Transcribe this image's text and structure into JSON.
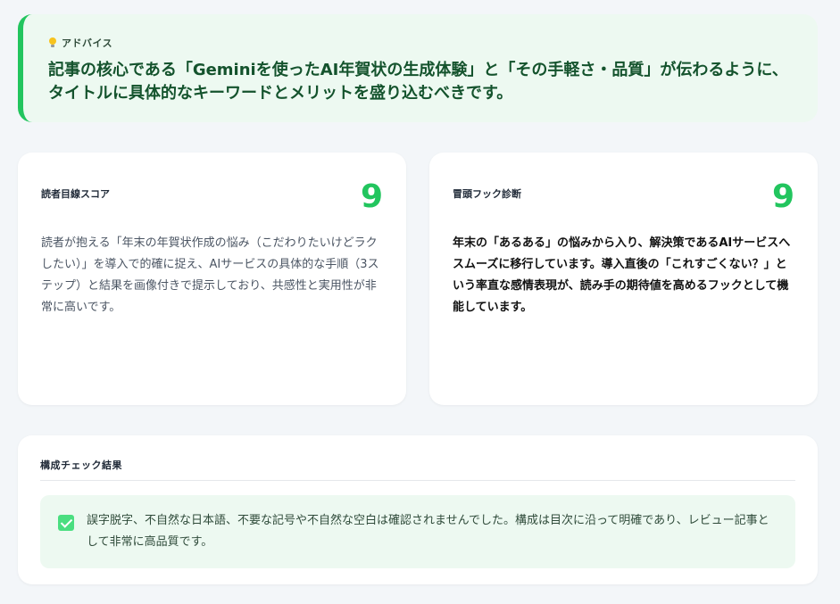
{
  "advice": {
    "icon": "lightbulb-icon",
    "label": "アドバイス",
    "text": "記事の核心である「Geminiを使ったAI年賀状の生成体験」と「その手軽さ・品質」が伝わるように、タイトルに具体的なキーワードとメリットを盛り込むべきです。"
  },
  "reader_score": {
    "title": "読者目線スコア",
    "score": "9",
    "text": "読者が抱える「年末の年賀状作成の悩み（こだわりたいけどラクしたい）」を導入で的確に捉え、AIサービスの具体的な手順（3ステップ）と結果を画像付きで提示しており、共感性と実用性が非常に高いです。"
  },
  "hook_diagnosis": {
    "title": "冒頭フック診断",
    "score": "9",
    "text": "年末の「あるある」の悩みから入り、解決策であるAIサービスへスムーズに移行しています。導入直後の「これすごくない？」という率直な感情表現が、読み手の期待値を高めるフックとして機能しています。"
  },
  "structure_check": {
    "title": "構成チェック結果",
    "icon": "checkbox-checked-icon",
    "text": "誤字脱字、不自然な日本語、不要な記号や不自然な空白は確認されませんでした。構成は目次に沿って明確であり、レビュー記事として非常に高品質です。"
  },
  "colors": {
    "accent_green": "#22c55e",
    "advice_bg": "#edf9f1",
    "advice_text": "#14532d"
  }
}
